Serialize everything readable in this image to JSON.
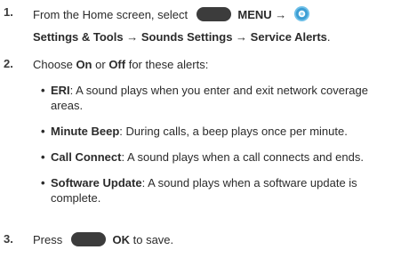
{
  "step1": {
    "number": "1.",
    "line1_prefix": "From the Home screen, select",
    "menu_label": "MENU",
    "arrow": "→",
    "path_settings": "Settings & Tools",
    "path_sounds": "Sounds Settings",
    "path_service": "Service Alerts",
    "period": "."
  },
  "step2": {
    "number": "2.",
    "choose": "Choose",
    "on": "On",
    "or": "or",
    "off": "Off",
    "rest": "for these alerts:",
    "items": [
      {
        "term": "ERI",
        "desc": ": A sound plays when you enter and exit network coverage areas."
      },
      {
        "term": "Minute Beep",
        "desc": ": During calls, a beep plays once per minute."
      },
      {
        "term": "Call Connect",
        "desc": ": A sound plays when a call connects and ends."
      },
      {
        "term": "Software Update",
        "desc": ": A sound plays when a software update is complete."
      }
    ]
  },
  "step3": {
    "number": "3.",
    "press": "Press",
    "ok_label": "OK",
    "rest": "to save."
  },
  "bullet_glyph": "•",
  "colors": {
    "text": "#2b2b2b",
    "key": "#3c3c3c",
    "gear_outer": "#4aa8d8",
    "gear_inner": "#ffffff"
  },
  "icons": {
    "soft_key": "soft-key-icon",
    "settings": "settings-gear-icon"
  }
}
